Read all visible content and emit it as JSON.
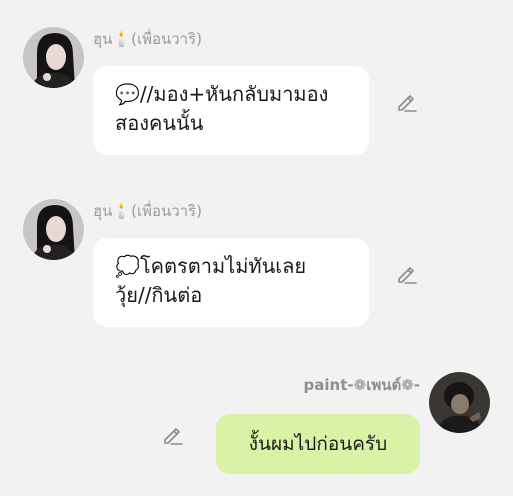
{
  "messages": [
    {
      "sender": "ฮุน🕯️(เพื่อนวาริ)",
      "text": "💬//มอง+หันกลับมามอง\nสองคนนั้น"
    },
    {
      "sender": "ฮุน🕯️(เพื่อนวาริ)",
      "text": "💭โคตรตามไม่ทันเลย\nวุ้ย//กินต่อ"
    },
    {
      "sender": "paint-❁เพนต์❁-",
      "text": "งั้นผมไปก่อนครับ"
    }
  ],
  "colors": {
    "background": "#f2f2f2",
    "incoming_bubble": "#ffffff",
    "outgoing_bubble": "#d8f2a6",
    "sender_name": "#9a9a9a"
  },
  "icons": {
    "edit": "pencil-icon"
  }
}
